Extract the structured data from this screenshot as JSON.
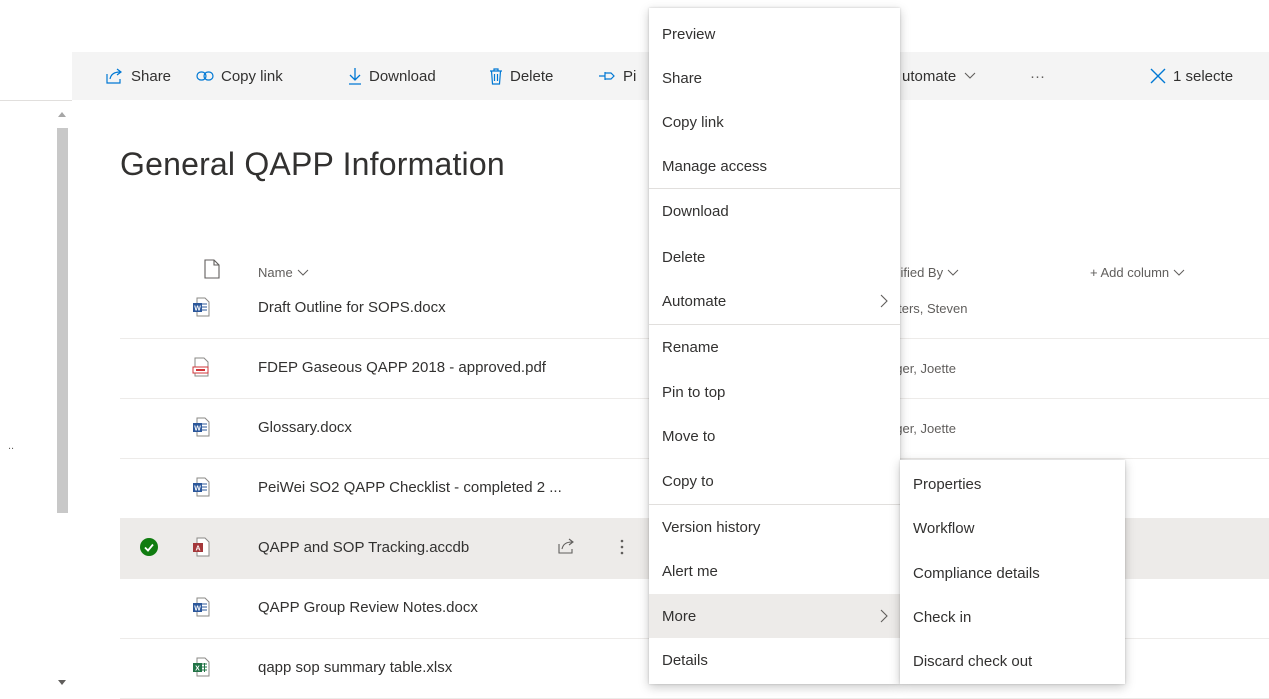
{
  "command_bar": {
    "share": "Share",
    "copy_link": "Copy link",
    "download": "Download",
    "delete": "Delete",
    "pin": "Pi",
    "automate": "utomate",
    "more": "···",
    "selected": "1 selecte"
  },
  "page": {
    "title": "General QAPP Information"
  },
  "list": {
    "headers": {
      "name": "Name",
      "modified_by": "odified By",
      "add_column": "+ Add column"
    },
    "rows": [
      {
        "name": "Draft Outline for SOPS.docx",
        "modified_by": "alters, Steven",
        "icon": "word-doc-icon"
      },
      {
        "name": "FDEP Gaseous QAPP 2018 - approved.pdf",
        "modified_by": "eger, Joette",
        "icon": "pdf-icon"
      },
      {
        "name": "Glossary.docx",
        "modified_by": "eger, Joette",
        "icon": "word-doc-icon"
      },
      {
        "name": "PeiWei SO2 QAPP Checklist - completed 2 ...",
        "modified_by": "",
        "icon": "word-doc-icon"
      },
      {
        "name": "QAPP and SOP Tracking.accdb",
        "modified_by": "",
        "icon": "access-db-icon",
        "selected": true
      },
      {
        "name": "QAPP Group Review Notes.docx",
        "modified_by": "",
        "icon": "word-doc-icon"
      },
      {
        "name": "qapp sop summary table.xlsx",
        "modified_by": "",
        "icon": "excel-icon"
      }
    ]
  },
  "context_menu": {
    "items": [
      "Preview",
      "Share",
      "Copy link",
      "Manage access",
      "Download",
      "Delete",
      "Automate",
      "Rename",
      "Pin to top",
      "Move to",
      "Copy to",
      "Version history",
      "Alert me",
      "More",
      "Details"
    ]
  },
  "submenu": {
    "items": [
      "Properties",
      "Workflow",
      "Compliance details",
      "Check in",
      "Discard check out"
    ]
  },
  "left_pane": {
    "dots": ".."
  },
  "colors": {
    "accent": "#0078d4",
    "check_green": "#107c10",
    "word": "#2b579a",
    "excel": "#217346",
    "pdf": "#d13438",
    "access": "#a4373a"
  }
}
